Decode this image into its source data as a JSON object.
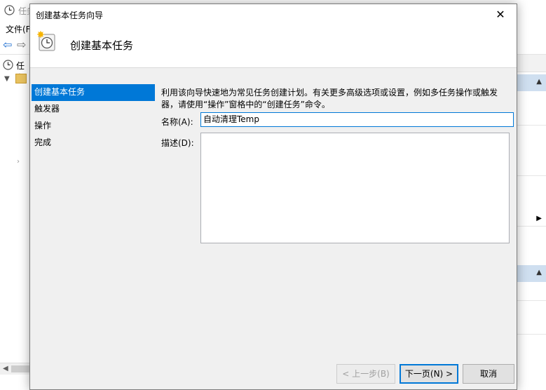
{
  "background_app": {
    "title": "任务",
    "menu_file": "文件(F",
    "tree_root": "任务",
    "back_arrow": "⇦",
    "forward_arrow": "⇨"
  },
  "dialog": {
    "title": "创建基本任务向导",
    "close_glyph": "✕",
    "header_title": "创建基本任务",
    "steps": [
      {
        "label": "创建基本任务",
        "active": true
      },
      {
        "label": "触发器",
        "active": false
      },
      {
        "label": "操作",
        "active": false
      },
      {
        "label": "完成",
        "active": false
      }
    ],
    "description": "利用该向导快速地为常见任务创建计划。有关更多高级选项或设置，例如多任务操作或触发器，请使用“操作”窗格中的“创建任务”命令。",
    "name_label": "名称(A):",
    "name_value": "自动清理Temp",
    "desc_label": "描述(D):",
    "desc_value": "",
    "buttons": {
      "back": "< 上一步(B)",
      "next": "下一页(N) >",
      "cancel": "取消"
    }
  },
  "colors": {
    "accent": "#0078d7",
    "dialog_bg": "#f0f0f0",
    "action_band": "#cfdff0"
  },
  "icons": [
    "clock-icon",
    "close-icon",
    "scheduler-wizard-icon",
    "back-arrow-icon",
    "forward-arrow-icon",
    "folder-icon"
  ]
}
